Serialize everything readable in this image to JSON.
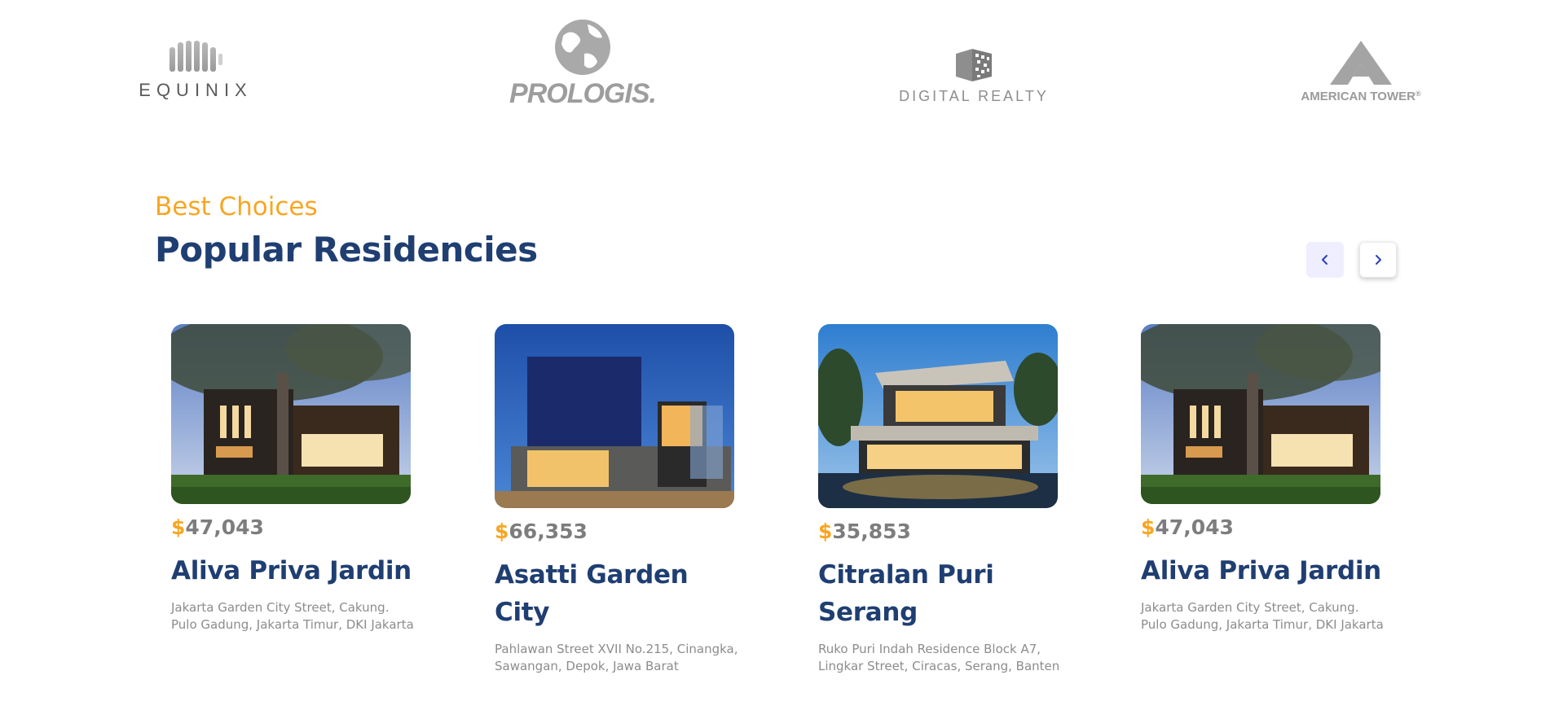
{
  "partners": [
    {
      "name": "EQUINIX",
      "icon": "equinix-bars-icon"
    },
    {
      "name": "PROLOGIS.",
      "icon": "globe-icon"
    },
    {
      "name": "DIGITAL REALTY",
      "icon": "digital-realty-cube-icon"
    },
    {
      "name": "AMERICAN TOWER",
      "registered": "®",
      "icon": "tower-triangle-icon"
    }
  ],
  "section": {
    "eyebrow": "Best Choices",
    "title": "Popular Residencies",
    "prev_icon": "chevron-left-icon",
    "next_icon": "chevron-right-icon"
  },
  "colors": {
    "accent": "#f7a623",
    "primary": "#1f3e72",
    "muted": "#8c8c8c",
    "prev_bg": "#eeeeff"
  },
  "residencies": [
    {
      "currency": "$",
      "price": "47,043",
      "name": "Aliva Priva Jardin",
      "address": "Jakarta Garden City Street, Cakung. Pulo Gadung, Jakarta Timur, DKI Jakarta",
      "image": "modern house with large tree at dusk"
    },
    {
      "currency": "$",
      "price": "66,353",
      "name": "Asatti Garden City",
      "address": "Pahlawan Street XVII No.215, Cinangka, Sawangan, Depok, Jawa Barat",
      "image": "dark cube modern house at blue hour"
    },
    {
      "currency": "$",
      "price": "35,853",
      "name": "Citralan Puri Serang",
      "address": "Ruko Puri Indah Residence Block A7, Lingkar Street, Ciracas, Serang, Banten",
      "image": "two-story villa with reflecting pool"
    },
    {
      "currency": "$",
      "price": "47,043",
      "name": "Aliva Priva Jardin",
      "address": "Jakarta Garden City Street, Cakung. Pulo Gadung, Jakarta Timur, DKI Jakarta",
      "image": "modern house with large tree at dusk"
    }
  ]
}
